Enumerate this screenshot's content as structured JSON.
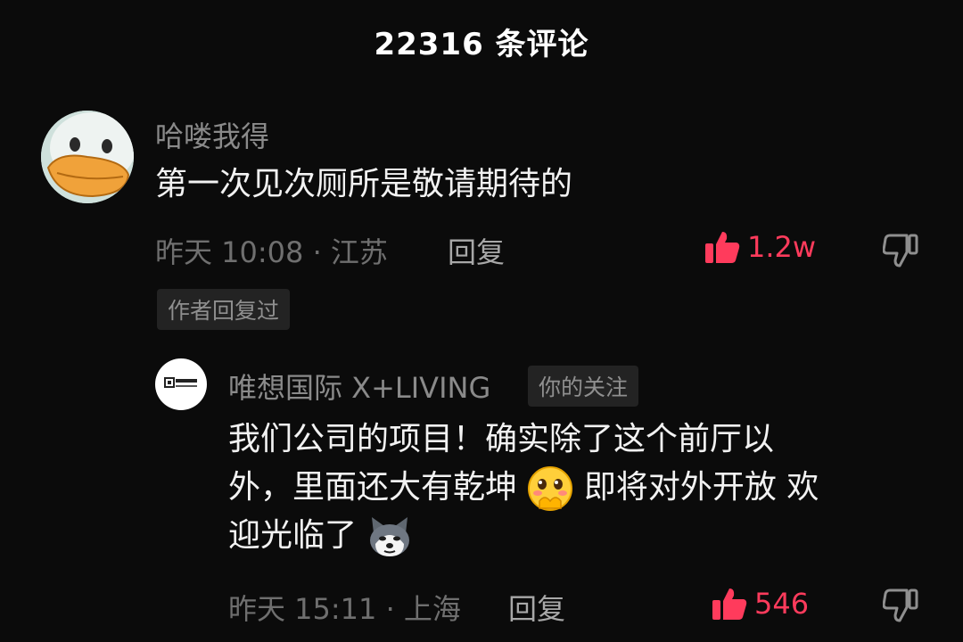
{
  "header": {
    "title": "22316 条评论"
  },
  "comments": [
    {
      "username": "哈喽我得",
      "text": "第一次见次厕所是敬请期待的",
      "time": "昨天 10:08 ·",
      "location": "江苏",
      "reply_label": "回复",
      "likes": "1.2w",
      "author_replied_tag": "作者回复过",
      "avatar": "duck-avatar"
    },
    {
      "username": "唯想国际 X+LIVING",
      "relation_tag": "你的关注",
      "text_line1": "我们公司的项目！确实除了这个前厅以",
      "text_line2a": "外，里面还大有乾坤",
      "text_line2b": "即将对外开放 欢",
      "text_line3a": "迎光临了",
      "time": "昨天 15:11 ·",
      "location": "上海",
      "reply_label": "回复",
      "likes": "546",
      "avatar": "company-logo-avatar",
      "emojis": [
        "blushing-pleading-emoji",
        "husky-dog-emoji"
      ]
    }
  ],
  "colors": {
    "background": "#0b0b0b",
    "like_active": "#ff3b5c",
    "meta_text": "#6f6f6f"
  }
}
